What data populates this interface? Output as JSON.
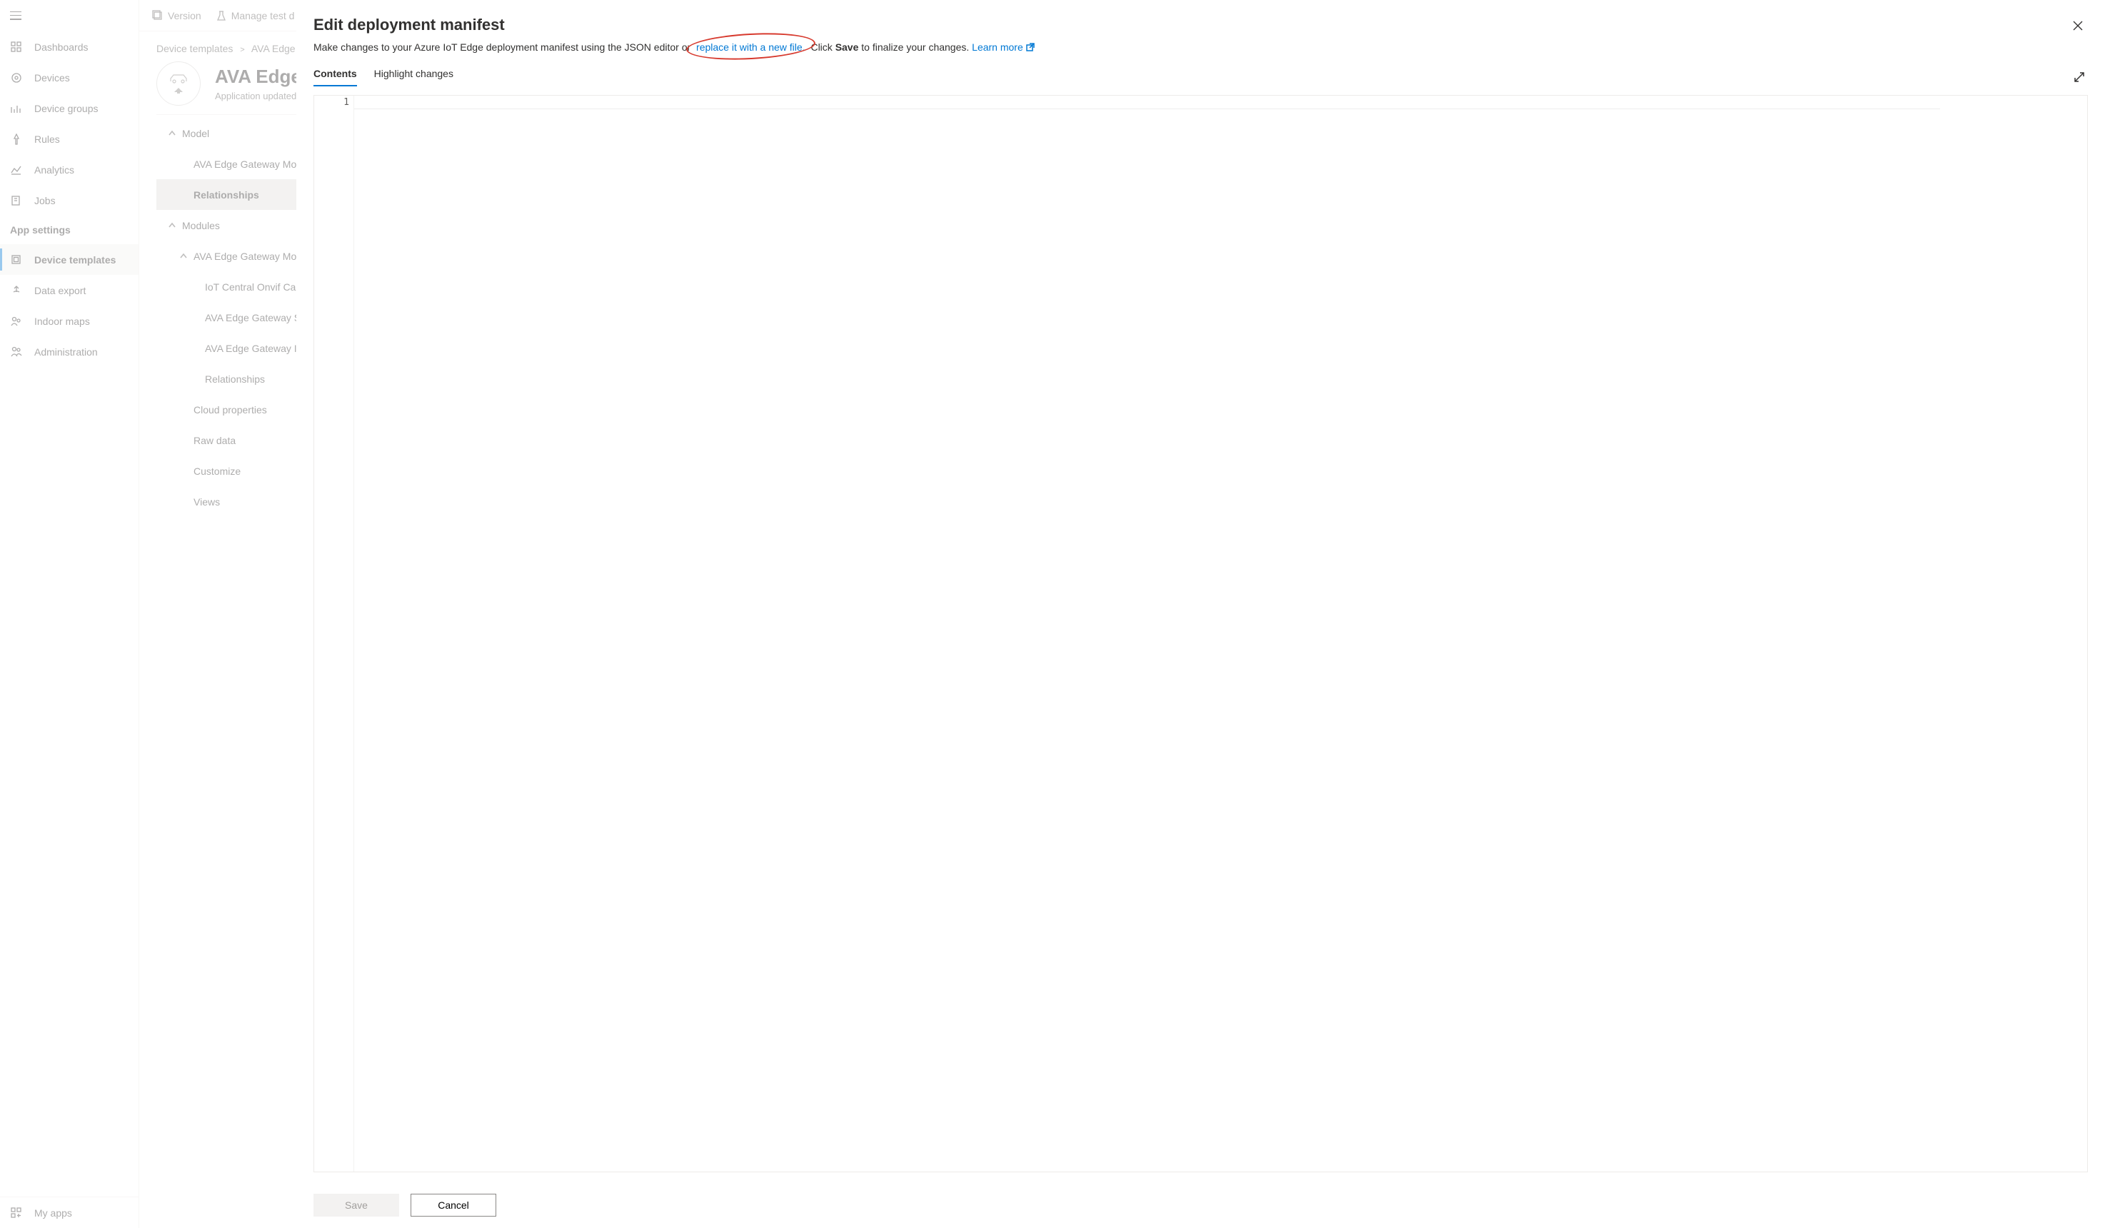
{
  "sidebar": {
    "items": [
      {
        "label": "Dashboards",
        "icon": "dashboard"
      },
      {
        "label": "Devices",
        "icon": "devices"
      },
      {
        "label": "Device groups",
        "icon": "device-groups"
      },
      {
        "label": "Rules",
        "icon": "rules"
      },
      {
        "label": "Analytics",
        "icon": "analytics"
      },
      {
        "label": "Jobs",
        "icon": "jobs"
      }
    ],
    "section_header": "App settings",
    "settings": [
      {
        "label": "Device templates",
        "icon": "device-templates",
        "active": true
      },
      {
        "label": "Data export",
        "icon": "data-export"
      },
      {
        "label": "Indoor maps",
        "icon": "indoor-maps"
      },
      {
        "label": "Administration",
        "icon": "administration"
      }
    ],
    "bottom": {
      "label": "My apps",
      "icon": "my-apps"
    }
  },
  "toolbar": {
    "version": "Version",
    "manage_test": "Manage test d"
  },
  "breadcrumbs": {
    "root": "Device templates",
    "current": "AVA Edge G"
  },
  "page": {
    "title": "AVA Edge",
    "subtitle": "Application updated:"
  },
  "tree": [
    {
      "label": "Model",
      "depth": 0,
      "expanded": true
    },
    {
      "label": "AVA Edge Gateway Mod",
      "depth": 1
    },
    {
      "label": "Relationships",
      "depth": 1,
      "selected": true
    },
    {
      "label": "Modules",
      "depth": 0,
      "expanded": true
    },
    {
      "label": "AVA Edge Gateway Mod",
      "depth": 1,
      "expanded": true,
      "chevron": true
    },
    {
      "label": "IoT Central Onvif Cam",
      "depth": 2
    },
    {
      "label": "AVA Edge Gateway Se",
      "depth": 2
    },
    {
      "label": "AVA Edge Gateway Int",
      "depth": 2
    },
    {
      "label": "Relationships",
      "depth": 2
    },
    {
      "label": "Cloud properties",
      "depth": 1
    },
    {
      "label": "Raw data",
      "depth": 1
    },
    {
      "label": "Customize",
      "depth": 1
    },
    {
      "label": "Views",
      "depth": 1
    }
  ],
  "panel": {
    "title": "Edit deployment manifest",
    "desc_pre": "Make changes to your Azure IoT Edge deployment manifest using the JSON editor or ",
    "desc_link": "replace it with a new file.",
    "desc_mid": " Click ",
    "desc_strong": "Save",
    "desc_post": " to finalize your changes. ",
    "learn_more": "Learn more",
    "tabs": {
      "contents": "Contents",
      "highlight": "Highlight changes"
    },
    "editor": {
      "line": "1"
    },
    "footer": {
      "save": "Save",
      "cancel": "Cancel"
    }
  }
}
